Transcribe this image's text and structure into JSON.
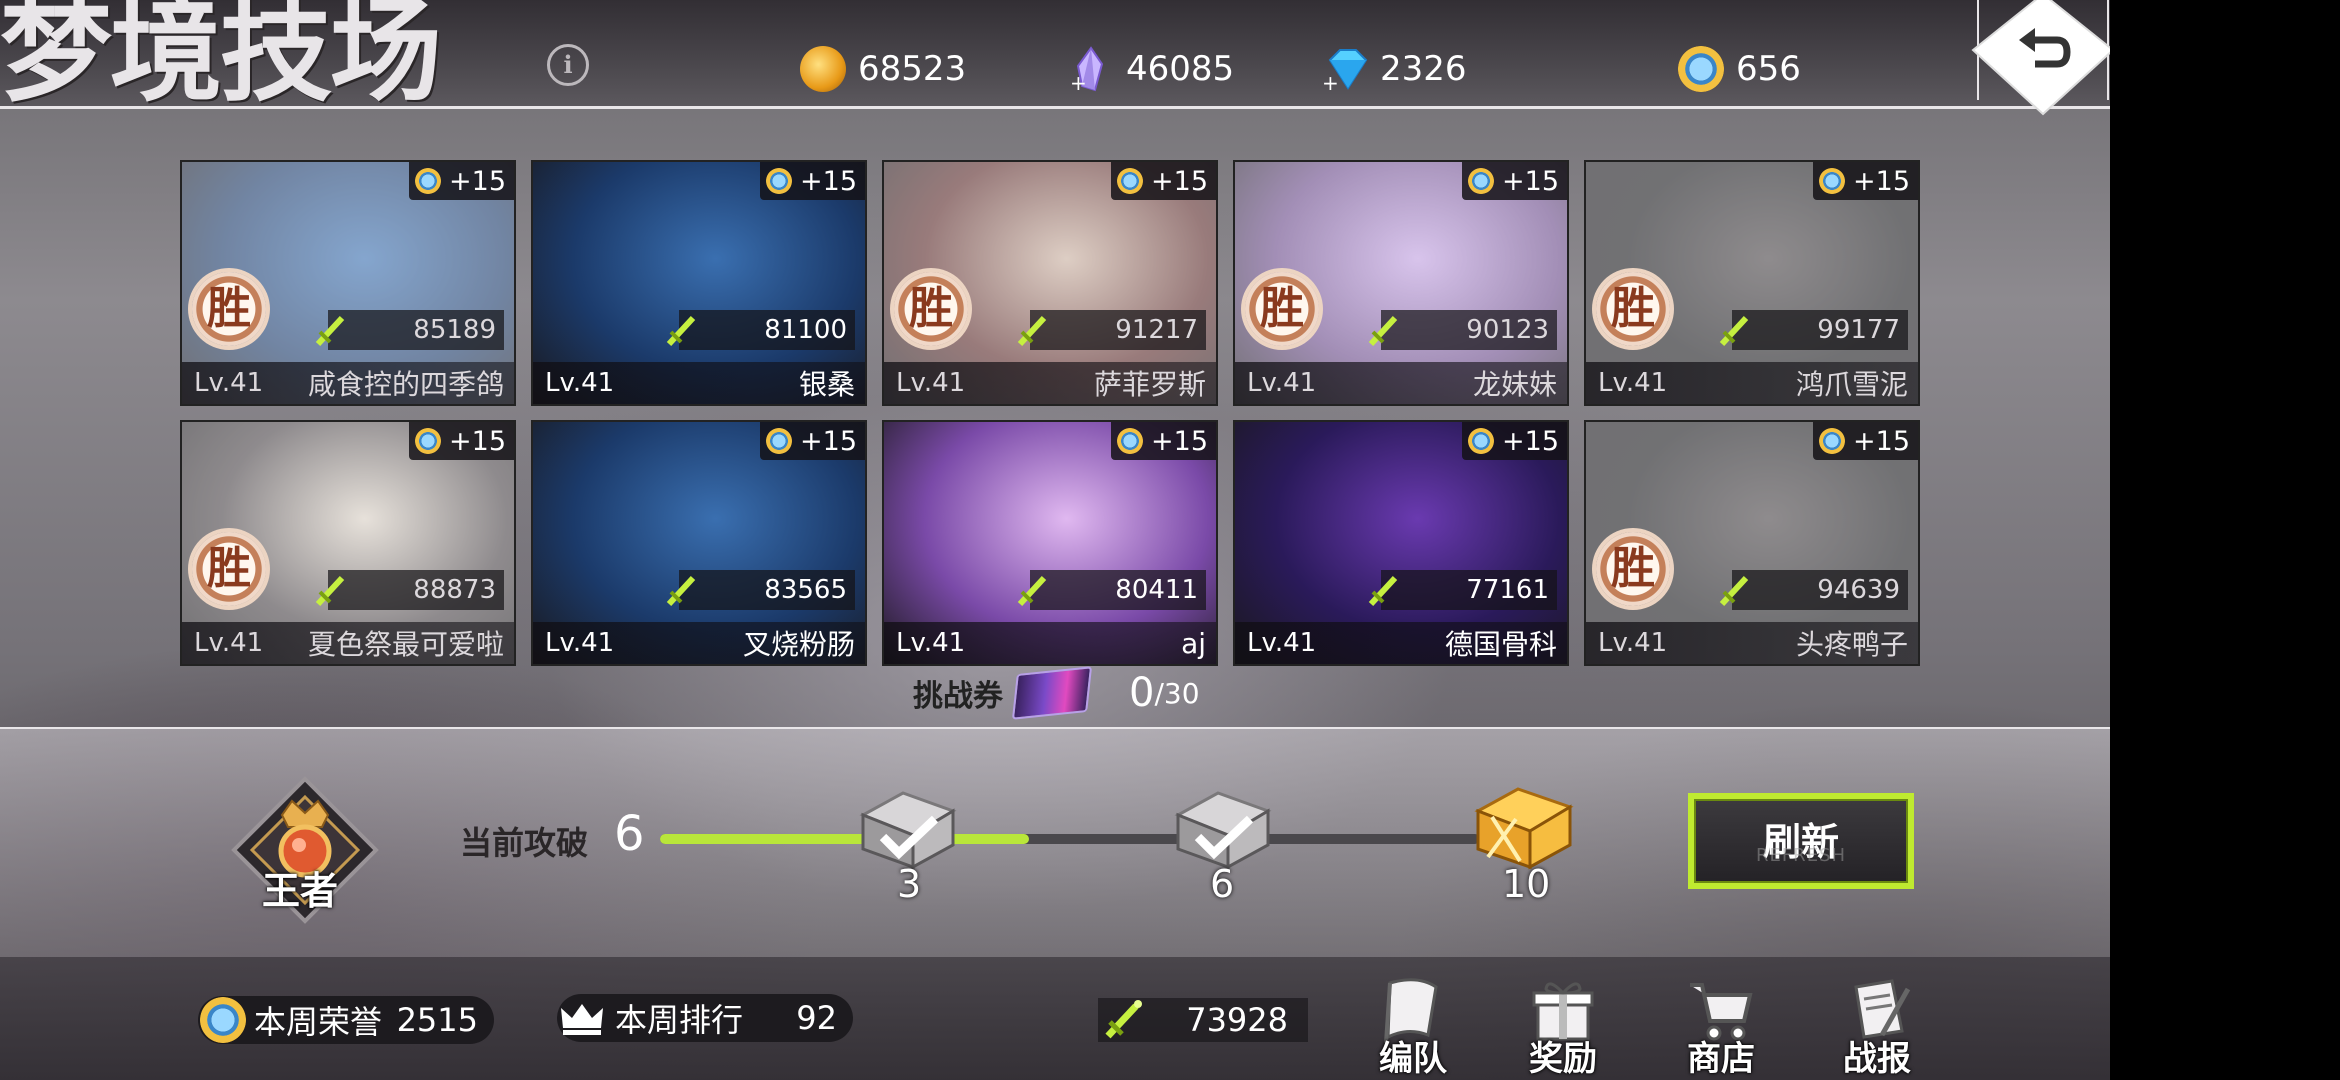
{
  "header": {
    "title": "梦境技场",
    "info_icon": "info-icon",
    "currencies": [
      {
        "icon": "gold-coin-plus-icon",
        "value": "68523"
      },
      {
        "icon": "crystal-plus-icon",
        "value": "46085"
      },
      {
        "icon": "diamond-plus-icon",
        "value": "2326"
      },
      {
        "icon": "honor-coin-icon",
        "value": "656"
      }
    ],
    "back_icon": "return-arrow-icon"
  },
  "opponents": [
    {
      "bonus": "+15",
      "power": "85189",
      "level": "Lv.41",
      "name": "咸食控的四季鸽",
      "won": true,
      "badge": "胜"
    },
    {
      "bonus": "+15",
      "power": "81100",
      "level": "Lv.41",
      "name": "银桑",
      "won": false,
      "badge": ""
    },
    {
      "bonus": "+15",
      "power": "91217",
      "level": "Lv.41",
      "name": "萨菲罗斯",
      "won": true,
      "badge": "胜"
    },
    {
      "bonus": "+15",
      "power": "90123",
      "level": "Lv.41",
      "name": "龙妹妹",
      "won": true,
      "badge": "胜"
    },
    {
      "bonus": "+15",
      "power": "99177",
      "level": "Lv.41",
      "name": "鸿爪雪泥",
      "won": true,
      "badge": "胜"
    },
    {
      "bonus": "+15",
      "power": "88873",
      "level": "Lv.41",
      "name": "夏色祭最可爱啦",
      "won": true,
      "badge": "胜"
    },
    {
      "bonus": "+15",
      "power": "83565",
      "level": "Lv.41",
      "name": "叉烧粉肠",
      "won": false,
      "badge": ""
    },
    {
      "bonus": "+15",
      "power": "80411",
      "level": "Lv.41",
      "name": "aj",
      "won": false,
      "badge": ""
    },
    {
      "bonus": "+15",
      "power": "77161",
      "level": "Lv.41",
      "name": "德国骨科",
      "won": false,
      "badge": ""
    },
    {
      "bonus": "+15",
      "power": "94639",
      "level": "Lv.41",
      "name": "头疼鸭子",
      "won": true,
      "badge": "胜"
    }
  ],
  "ticket": {
    "label": "挑战券",
    "count": "0",
    "total": "/30"
  },
  "progress": {
    "rank_name": "王者",
    "current_label": "当前攻破",
    "current_value": "6",
    "fill_fraction": 0.45,
    "chests": [
      {
        "threshold": "3",
        "state": "claimed"
      },
      {
        "threshold": "6",
        "state": "claimed"
      },
      {
        "threshold": "10",
        "state": "locked"
      }
    ]
  },
  "refresh_button": {
    "label": "刷新",
    "sub": "REFRESH"
  },
  "bottom": {
    "honor_label": "本周荣誉",
    "honor_value": "2515",
    "rank_label": "本周排行",
    "rank_value": "92",
    "team_power": "73928",
    "nav": [
      {
        "label": "编队",
        "icon": "banner-flag-icon"
      },
      {
        "label": "奖励",
        "icon": "gift-box-icon"
      },
      {
        "label": "商店",
        "icon": "shopping-cart-icon"
      },
      {
        "label": "战报",
        "icon": "battle-report-icon"
      }
    ]
  },
  "colors": {
    "accent": "#bfea30",
    "progress_fill": "#b9e63a",
    "win_badge": "#c4805a"
  }
}
